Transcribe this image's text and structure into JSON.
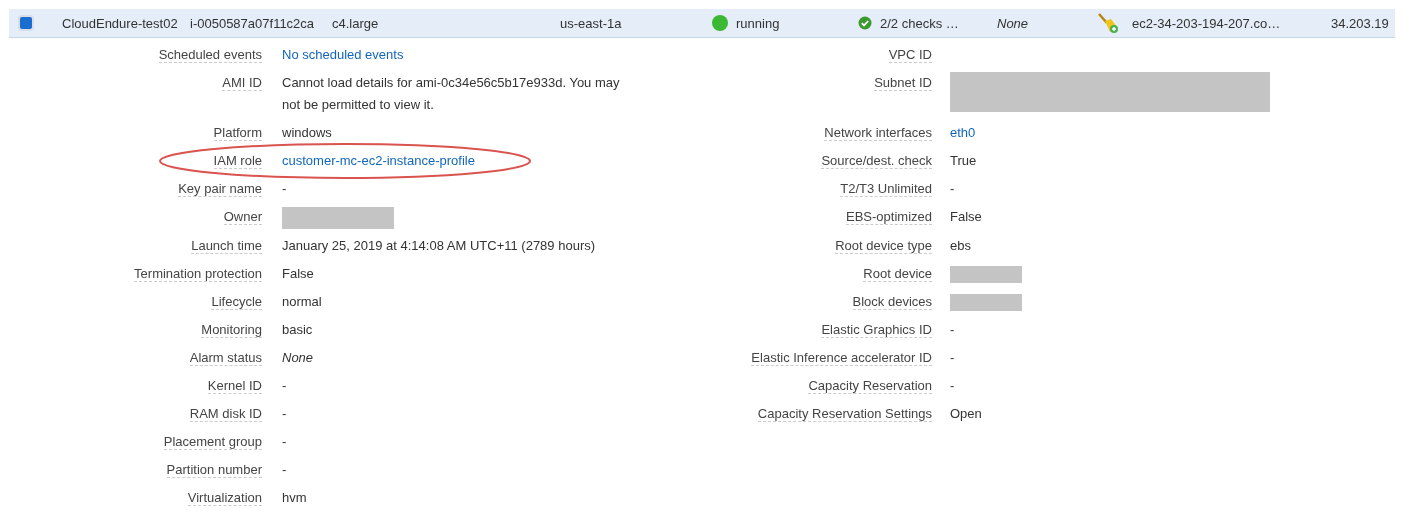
{
  "instance_row": {
    "selected": true,
    "name": "CloudEndure-test02",
    "instance_id": "i-0050587a07f11c2ca",
    "instance_type": "c4.large",
    "availability_zone": "us-east-1a",
    "state": "running",
    "status_checks": "2/2 checks …",
    "alarm_status": "None",
    "public_dns": "ec2-34-203-194-207.co…",
    "ipv4": "34.203.19"
  },
  "details": [
    {
      "left": {
        "label": "Scheduled events",
        "value": "No scheduled events",
        "kind": "link"
      },
      "right": {
        "label": "VPC ID"
      }
    },
    {
      "left": {
        "label": "AMI ID",
        "value": "Cannot load details for ami-0c34e56c5b17e933d. You may not be permitted to view it.",
        "kind": "text"
      },
      "right": {
        "label": "Subnet ID",
        "kind": "redacted"
      }
    },
    {
      "left": {
        "label": "Platform",
        "value": "windows",
        "kind": "text"
      },
      "right": {
        "label": "Network interfaces",
        "value": "eth0",
        "kind": "link"
      }
    },
    {
      "left": {
        "label": "IAM role",
        "value": "customer-mc-ec2-instance-profile",
        "kind": "link",
        "circled": true
      },
      "right": {
        "label": "Source/dest. check",
        "value": "True",
        "kind": "text"
      }
    },
    {
      "left": {
        "label": "Key pair name",
        "value": "-",
        "kind": "text"
      },
      "right": {
        "label": "T2/T3 Unlimited",
        "value": "-",
        "kind": "text"
      }
    },
    {
      "left": {
        "label": "Owner",
        "kind": "redacted"
      },
      "right": {
        "label": "EBS-optimized",
        "value": "False",
        "kind": "text"
      }
    },
    {
      "left": {
        "label": "Launch time",
        "value": "January 25, 2019 at 4:14:08 AM UTC+11 (2789 hours)",
        "kind": "text"
      },
      "right": {
        "label": "Root device type",
        "value": "ebs",
        "kind": "text"
      }
    },
    {
      "left": {
        "label": "Termination protection",
        "value": "False",
        "kind": "text"
      },
      "right": {
        "label": "Root device",
        "kind": "redacted"
      }
    },
    {
      "left": {
        "label": "Lifecycle",
        "value": "normal",
        "kind": "text"
      },
      "right": {
        "label": "Block devices",
        "kind": "redacted"
      }
    },
    {
      "left": {
        "label": "Monitoring",
        "value": "basic",
        "kind": "text"
      },
      "right": {
        "label": "Elastic Graphics ID",
        "value": "-",
        "kind": "text"
      }
    },
    {
      "left": {
        "label": "Alarm status",
        "value": "None",
        "kind": "italic"
      },
      "right": {
        "label": "Elastic Inference accelerator ID",
        "value": "-",
        "kind": "text"
      }
    },
    {
      "left": {
        "label": "Kernel ID",
        "value": "-",
        "kind": "text"
      },
      "right": {
        "label": "Capacity Reservation",
        "value": "-",
        "kind": "text"
      }
    },
    {
      "left": {
        "label": "RAM disk ID",
        "value": "-",
        "kind": "text"
      },
      "right": {
        "label": "Capacity Reservation Settings",
        "value": "Open",
        "kind": "text"
      }
    },
    {
      "left": {
        "label": "Placement group",
        "value": "-",
        "kind": "text"
      }
    },
    {
      "left": {
        "label": "Partition number",
        "value": "-",
        "kind": "text"
      }
    },
    {
      "left": {
        "label": "Virtualization",
        "value": "hvm",
        "kind": "text"
      }
    }
  ]
}
